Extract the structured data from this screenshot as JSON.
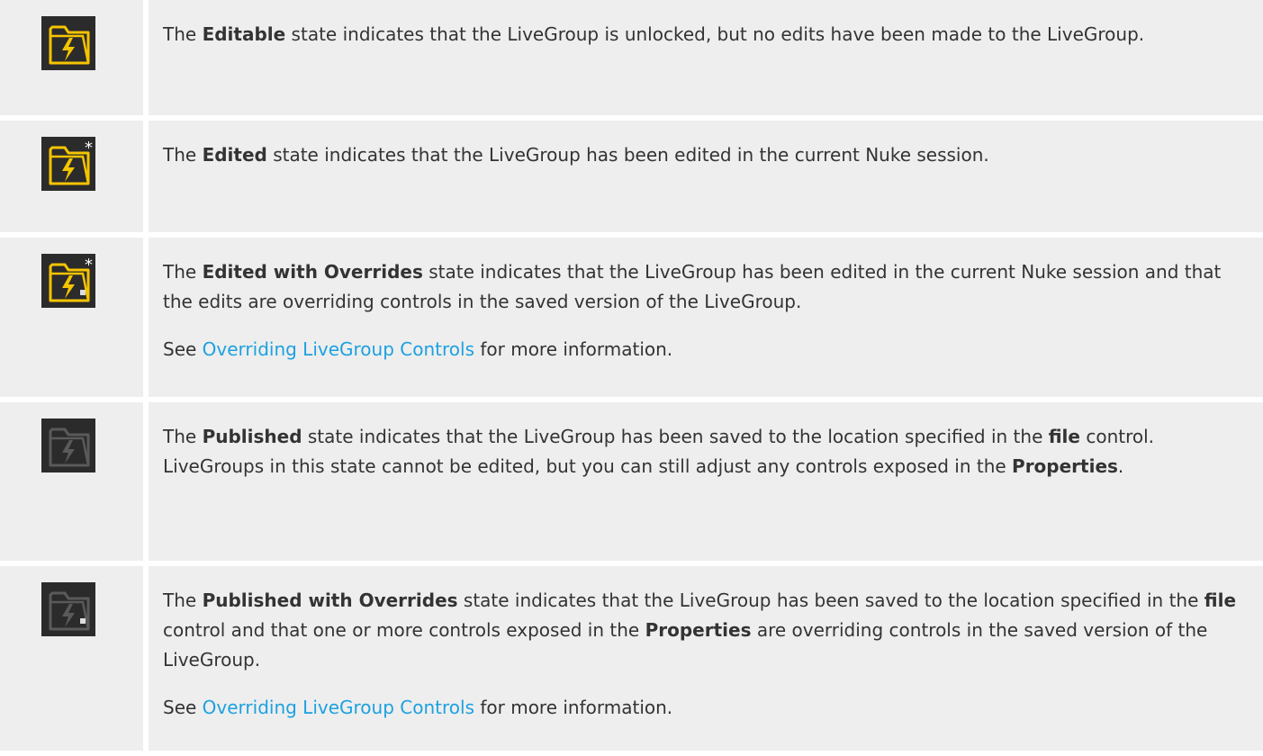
{
  "rows": [
    {
      "icon": "livegroup-editable-icon",
      "text": {
        "p1_a": "The ",
        "p1_b": "Editable",
        "p1_c": " state indicates that the LiveGroup is unlocked, but no edits have been made to the LiveGroup."
      }
    },
    {
      "icon": "livegroup-edited-icon",
      "text": {
        "p1_a": "The ",
        "p1_b": "Edited",
        "p1_c": " state indicates that the LiveGroup has been edited in the current Nuke session."
      }
    },
    {
      "icon": "livegroup-edited-overrides-icon",
      "text": {
        "p1_a": "The ",
        "p1_b": "Edited with Overrides",
        "p1_c": " state indicates that the LiveGroup has been edited in the current Nuke session and that the edits are overriding controls in the saved version of the LiveGroup.",
        "p2_a": "See ",
        "p2_link": "Overriding LiveGroup Controls",
        "p2_c": " for more information."
      }
    },
    {
      "icon": "livegroup-published-icon",
      "text": {
        "p1_a": "The ",
        "p1_b": "Published",
        "p1_c": " state indicates that the LiveGroup has been saved to the location specified in the ",
        "p1_d": "file",
        "p1_e": " control. LiveGroups in this state cannot be edited, but you can still adjust any controls exposed in the ",
        "p1_f": "Properties",
        "p1_g": "."
      }
    },
    {
      "icon": "livegroup-published-overrides-icon",
      "text": {
        "p1_a": "The ",
        "p1_b": "Published with Overrides",
        "p1_c": " state indicates that the LiveGroup has been saved to the location specified in the ",
        "p1_d": "file",
        "p1_e": " control and that one or more controls exposed in the ",
        "p1_f": "Properties",
        "p1_g": " are overriding controls in the saved version of the LiveGroup.",
        "p2_a": "See ",
        "p2_link": "Overriding LiveGroup Controls",
        "p2_c": " for more information."
      }
    }
  ],
  "colors": {
    "row_bg": "#eeeeee",
    "text": "#333333",
    "link": "#1da1e0",
    "icon_active": "#f5c400",
    "icon_inactive": "#5a5a5a",
    "icon_bg": "#2b2b2b"
  }
}
